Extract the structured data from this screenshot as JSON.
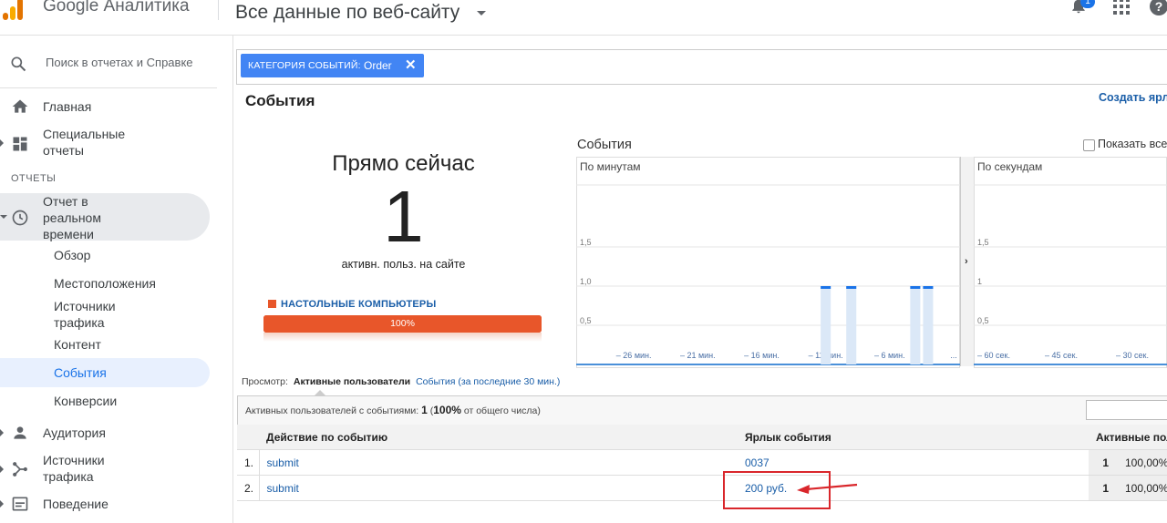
{
  "header": {
    "brand": "Google Аналитика",
    "property": "Все данные по веб-сайту",
    "notification_count": "1",
    "help_label": "?"
  },
  "sidebar": {
    "search_placeholder": "Поиск в отчетах и Справке",
    "home": "Главная",
    "custom_reports": "Специальные отчеты",
    "reports_header": "ОТЧЕТЫ",
    "realtime": "Отчет в реальном времени",
    "realtime_items": [
      "Обзор",
      "Местоположения",
      "Источники трафика",
      "Контент",
      "События",
      "Конверсии"
    ],
    "audience": "Аудитория",
    "acquisition": "Источники трафика",
    "behavior": "Поведение"
  },
  "filter": {
    "category_label": "КАТЕГОРИЯ СОБЫТИЙ:",
    "category_value": "Order",
    "close_glyph": "✕"
  },
  "page": {
    "title": "События",
    "create_shortcut": "Создать ярлык"
  },
  "right_now": {
    "title": "Прямо сейчас",
    "active_users": "1",
    "caption": "активн. польз. на сайте",
    "device_label": "НАСТОЛЬНЫЕ КОМПЬЮТЕРЫ",
    "device_share": 1.0,
    "device_share_label": "100%",
    "device_color": "#e8562a"
  },
  "chart_data": [
    {
      "type": "bar",
      "title": "События",
      "subtitle": "По минутам",
      "y_ticks": [
        "1,5",
        "1,0",
        "0,5"
      ],
      "ylim": [
        0,
        2
      ],
      "x_tick_labels": [
        "– 26 мин.",
        "– 21 мин.",
        "– 16 мин.",
        "– 11 мин.",
        "– 6 мин.",
        "..."
      ],
      "minutes_ago": [
        -30,
        -29,
        -28,
        -27,
        -26,
        -25,
        -24,
        -23,
        -22,
        -21,
        -20,
        -19,
        -18,
        -17,
        -16,
        -15,
        -14,
        -13,
        -12,
        -11,
        -10,
        -9,
        -8,
        -7,
        -6,
        -5,
        -4,
        -3,
        -2,
        -1
      ],
      "values": [
        0,
        0,
        0,
        0,
        0,
        0,
        0,
        0,
        0,
        0,
        0,
        0,
        0,
        0,
        0,
        0,
        0,
        0,
        0,
        1,
        0,
        1,
        0,
        0,
        0,
        0,
        1,
        1,
        0,
        0
      ],
      "color": "#1a73e8"
    },
    {
      "type": "bar",
      "subtitle": "По секундам",
      "y_ticks": [
        "1,5",
        "1",
        "0,5"
      ],
      "ylim": [
        0,
        2
      ],
      "x_tick_labels": [
        "– 60 сек.",
        "– 45 сек.",
        "– 30 сек."
      ],
      "values": []
    }
  ],
  "chart_controls": {
    "show_all": "Показать все",
    "expand_glyph": "›"
  },
  "view": {
    "label": "Просмотр:",
    "active_tab": "Активные пользователи",
    "other_tab": "События (за последние 30 мин.)"
  },
  "summary": {
    "prefix": "Активных пользователей с событиями:",
    "count": "1",
    "percent": "100%",
    "suffix": "от общего числа"
  },
  "table": {
    "columns": [
      "Действие по событию",
      "Ярлык события",
      "Активные пользователи"
    ],
    "rows": [
      {
        "index": "1.",
        "action": "submit",
        "label": "0037",
        "users": "1",
        "pct": "100,00%"
      },
      {
        "index": "2.",
        "action": "submit",
        "label": "200 руб.",
        "users": "1",
        "pct": "100,00%"
      }
    ]
  },
  "annotation_color": "#d9262b"
}
